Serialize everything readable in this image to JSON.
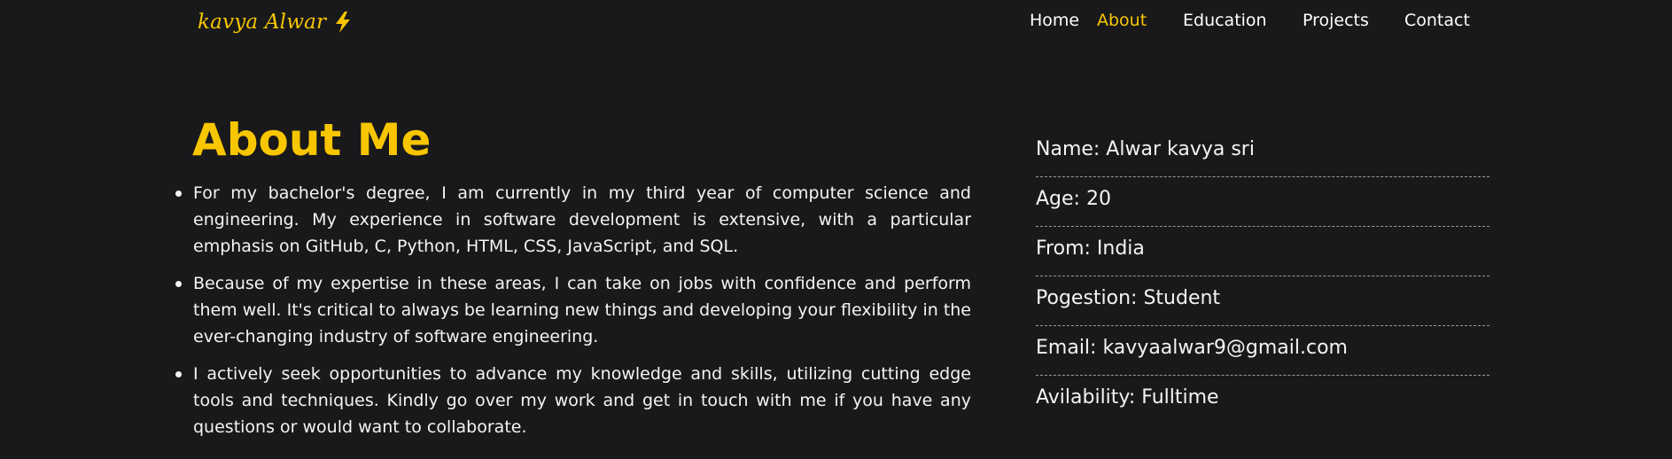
{
  "header": {
    "logo_text": "kavya Alwar",
    "logo_icon": "lightning-bolt-icon",
    "nav": [
      {
        "label": "Home",
        "active": false
      },
      {
        "label": "About",
        "active": true
      },
      {
        "label": "Education",
        "active": false
      },
      {
        "label": "Projects",
        "active": false
      },
      {
        "label": "Contact",
        "active": false
      }
    ]
  },
  "about": {
    "title": "About Me",
    "paragraphs": [
      "For my bachelor's degree, I am currently in my third year of computer science and engineering. My experience in software development is extensive, with a particular emphasis on GitHub, C, Python, HTML, CSS, JavaScript, and SQL.",
      "Because of my expertise in these areas, I can take on jobs with confidence and perform them well. It's critical to always be learning new things and developing your flexibility in the ever-changing industry of software engineering.",
      "I actively seek opportunities to advance my knowledge and skills, utilizing cutting edge tools and techniques. Kindly go over my work and get in touch with me if you have any questions or would want to collaborate."
    ]
  },
  "info": [
    "Name: Alwar kavya sri",
    "Age: 20",
    "From: India",
    "Pogestion: Student",
    "Email: kavyaalwar9@gmail.com",
    "Avilability: Fulltime"
  ],
  "colors": {
    "background": "#19191b",
    "accent": "#f7c600",
    "text": "#f4f4f4"
  }
}
